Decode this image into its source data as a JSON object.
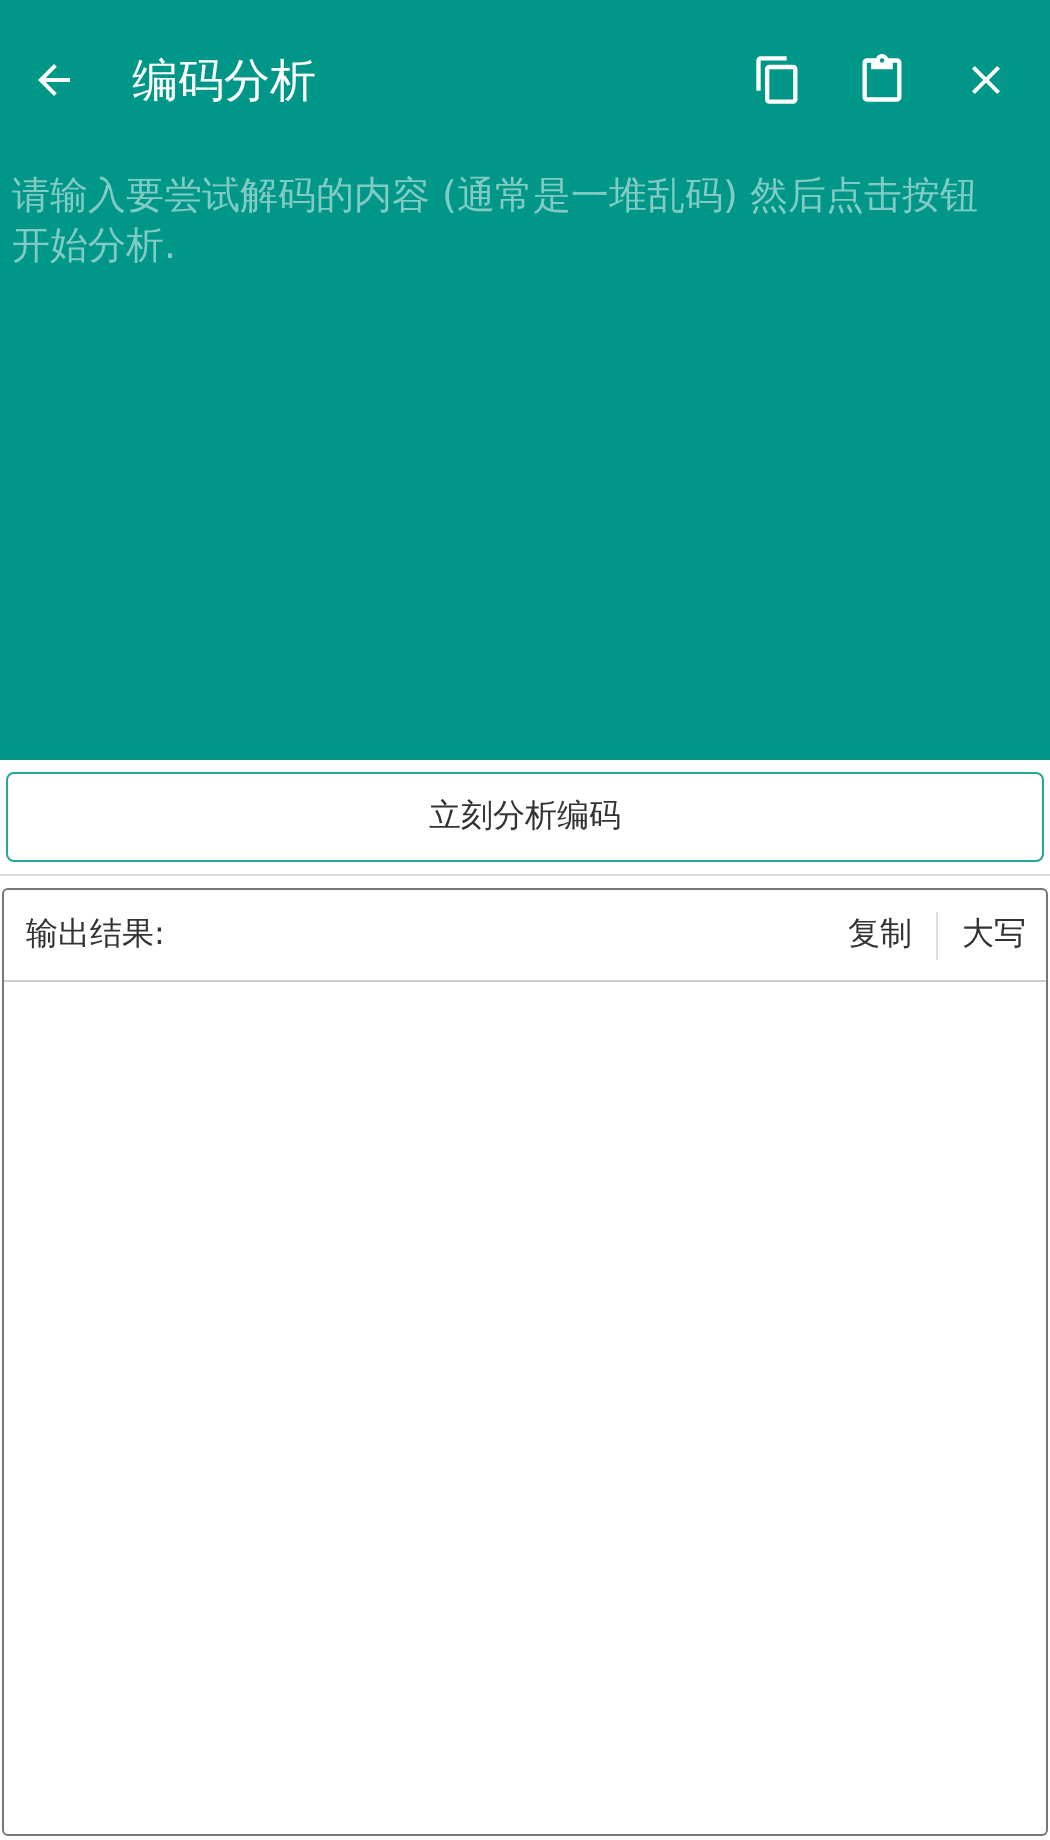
{
  "app_bar": {
    "title": "编码分析"
  },
  "input": {
    "placeholder": "请输入要尝试解码的内容 (通常是一堆乱码) 然后点击按钮开始分析."
  },
  "analyze_button": {
    "label": "立刻分析编码"
  },
  "output": {
    "label": "输出结果:",
    "actions": [
      "复制",
      "大写"
    ]
  }
}
